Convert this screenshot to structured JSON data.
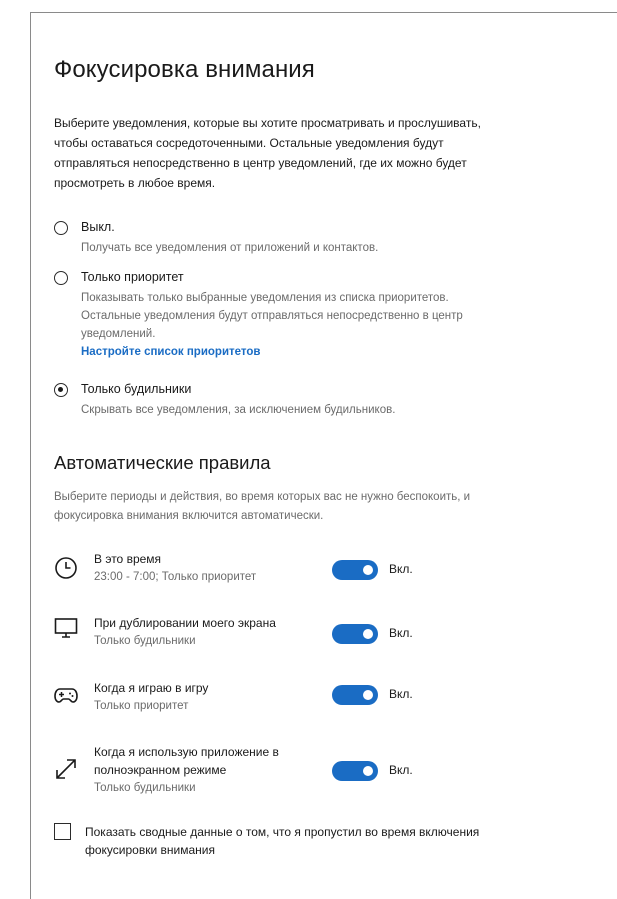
{
  "page": {
    "title": "Фокусировка внимания",
    "description": "Выберите уведомления, которые вы хотите просматривать и прослушивать, чтобы оставаться сосредоточенными. Остальные уведомления будут отправляться непосредственно в центр уведомлений, где их можно будет просмотреть в любое время."
  },
  "options": [
    {
      "label": "Выкл.",
      "description": "Получать все уведомления от приложений и контактов.",
      "selected": false
    },
    {
      "label": "Только приоритет",
      "description": "Показывать только выбранные уведомления из списка приоритетов. Остальные уведомления будут отправляться непосредственно в центр уведомлений.",
      "link": "Настройте список приоритетов",
      "selected": false
    },
    {
      "label": "Только будильники",
      "description": "Скрывать все уведомления, за исключением будильников.",
      "selected": true
    }
  ],
  "rules_section": {
    "title": "Автоматические правила",
    "description": "Выберите периоды и действия, во время которых вас не нужно беспокоить, и фокусировка внимания включится автоматически."
  },
  "rules": [
    {
      "icon": "clock-icon",
      "title": "В это время",
      "subtitle": "23:00 - 7:00; Только приоритет",
      "toggle_on": true,
      "toggle_label": "Вкл."
    },
    {
      "icon": "monitor-icon",
      "title": "При дублировании моего экрана",
      "subtitle": "Только будильники",
      "toggle_on": true,
      "toggle_label": "Вкл."
    },
    {
      "icon": "gamepad-icon",
      "title": "Когда я играю в игру",
      "subtitle": "Только приоритет",
      "toggle_on": true,
      "toggle_label": "Вкл."
    },
    {
      "icon": "fullscreen-arrow-icon",
      "title": "Когда я использую приложение в полноэкранном режиме",
      "subtitle": "Только будильники",
      "toggle_on": true,
      "toggle_label": "Вкл."
    }
  ],
  "summary_checkbox": {
    "label": "Показать сводные данные о том, что я пропустил во время включения фокусировки внимания",
    "checked": false
  },
  "colors": {
    "accent": "#1a6cc4",
    "secondary_text": "#6b6b6b"
  }
}
